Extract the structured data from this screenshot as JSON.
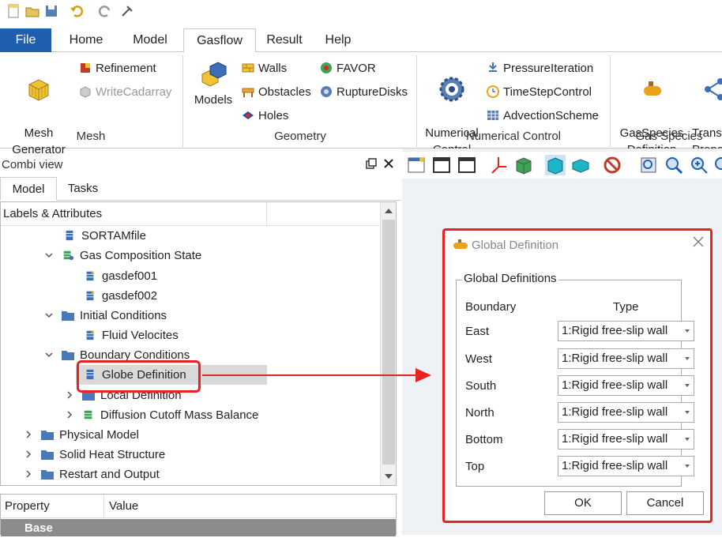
{
  "quick_access": [
    "new-icon",
    "open-icon",
    "save-icon",
    "undo-icon",
    "redo-icon",
    "customize-icon"
  ],
  "menu": {
    "file": "File",
    "tabs": [
      "Home",
      "Model",
      "Gasflow",
      "Result",
      "Help"
    ],
    "active_tab": "Gasflow"
  },
  "ribbon": {
    "mesh": {
      "mesh_generator": "Mesh\nGenerator",
      "refinement": "Refinement",
      "write_cadarray": "WriteCadarray",
      "label": "Mesh"
    },
    "geometry": {
      "models": "Models",
      "walls": "Walls",
      "obstacles": "Obstacles",
      "holes": "Holes",
      "favor": "FAVOR",
      "rupture_disks": "RuptureDisks",
      "label": "Geometry"
    },
    "numerical": {
      "numerical_control": "Numerical\nControl",
      "pressure_iteration": "PressureIteration",
      "time_step_control": "TimeStepControl",
      "advection_scheme": "AdvectionScheme",
      "label": "Numerical Control"
    },
    "gas_species": {
      "gas_species_definition": "GasSpecies\nDefinition",
      "transport_properties": "Trans\nPrope",
      "label": "Gas Species"
    }
  },
  "combi_view": {
    "title": "Combi view",
    "tabs": [
      "Model",
      "Tasks"
    ],
    "tree_header": "Labels & Attributes",
    "tree": [
      {
        "label": "SORTAMfile"
      },
      {
        "label": "Gas Composition State"
      },
      {
        "label": "gasdef001"
      },
      {
        "label": "gasdef002"
      },
      {
        "label": "Initial Conditions"
      },
      {
        "label": "Fluid Velocites"
      },
      {
        "label": "Boundary Conditions"
      },
      {
        "label": "Globe Definition"
      },
      {
        "label": "Local Definition"
      },
      {
        "label": "Diffusion Cutoff Mass Balance"
      },
      {
        "label": "Physical Model"
      },
      {
        "label": "Solid Heat Structure"
      },
      {
        "label": "Restart and Output"
      }
    ],
    "selected": "Globe Definition"
  },
  "property_panel": {
    "col_property": "Property",
    "col_value": "Value",
    "group": "Base"
  },
  "dialog": {
    "title": "Global Definition",
    "group_title": "Global Definitions",
    "col_boundary": "Boundary",
    "col_type": "Type",
    "rows": [
      {
        "boundary": "East",
        "type": "1:Rigid free-slip wall"
      },
      {
        "boundary": "West",
        "type": "1:Rigid free-slip wall"
      },
      {
        "boundary": "South",
        "type": "1:Rigid free-slip wall"
      },
      {
        "boundary": "North",
        "type": "1:Rigid free-slip wall"
      },
      {
        "boundary": "Bottom",
        "type": "1:Rigid free-slip wall"
      },
      {
        "boundary": "Top",
        "type": "1:Rigid free-slip wall"
      }
    ],
    "ok": "OK",
    "cancel": "Cancel"
  },
  "colors": {
    "accent": "#1f5fb0",
    "highlight": "#e8231f",
    "selection": "#d9d9d9"
  }
}
